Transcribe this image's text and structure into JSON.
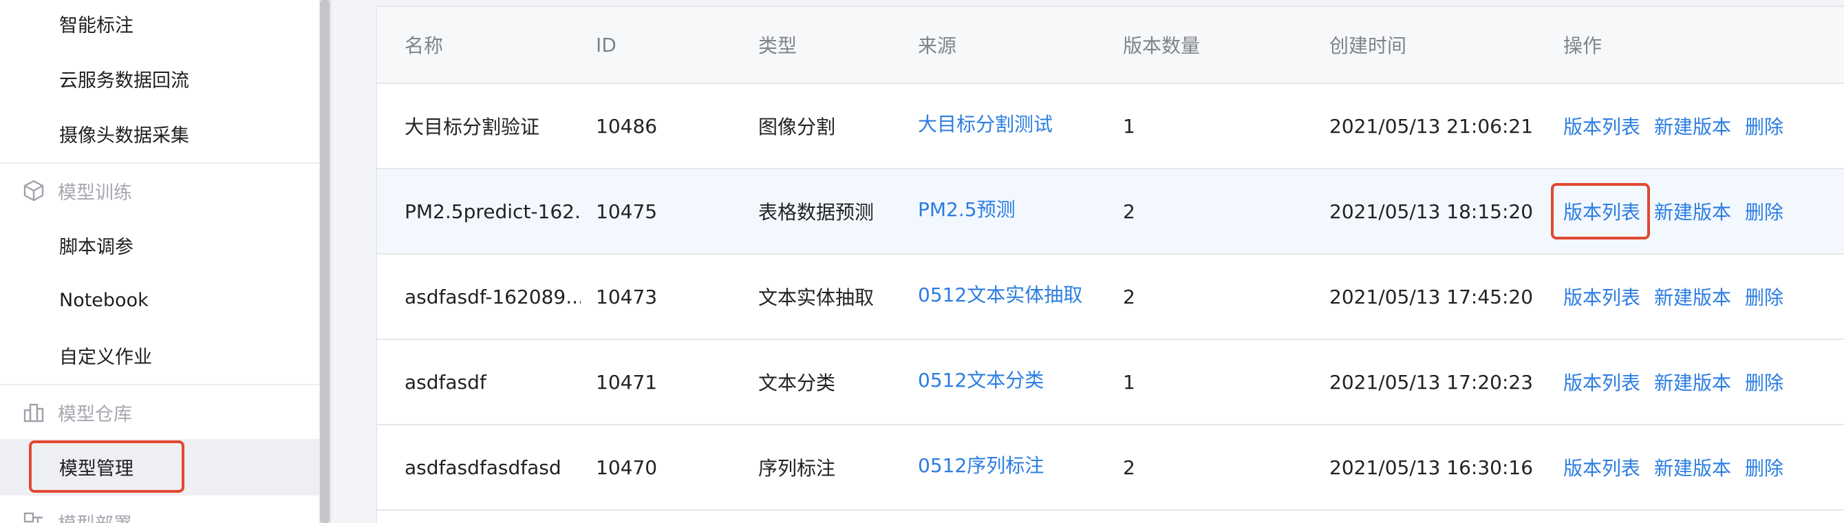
{
  "sidebar": {
    "items": [
      {
        "label": "智能标注"
      },
      {
        "label": "云服务数据回流"
      },
      {
        "label": "摄像头数据采集"
      },
      {
        "label": "模型训练"
      },
      {
        "label": "脚本调参"
      },
      {
        "label": "Notebook"
      },
      {
        "label": "自定义作业"
      },
      {
        "label": "模型仓库"
      },
      {
        "label": "模型管理"
      },
      {
        "label": "模型部署"
      }
    ]
  },
  "table": {
    "headers": {
      "name": "名称",
      "id": "ID",
      "type": "类型",
      "source": "来源",
      "versions": "版本数量",
      "created": "创建时间",
      "actions": "操作"
    },
    "actions": {
      "version_list": "版本列表",
      "new_version": "新建版本",
      "delete": "删除"
    },
    "rows": [
      {
        "name": "大目标分割验证",
        "id": "10486",
        "type": "图像分割",
        "source": "大目标分割测试",
        "versions": "1",
        "created": "2021/05/13 21:06:21"
      },
      {
        "name": "PM2.5predict-162...",
        "id": "10475",
        "type": "表格数据预测",
        "source": "PM2.5预测",
        "versions": "2",
        "created": "2021/05/13 18:15:20"
      },
      {
        "name": "asdfasdf-162089...",
        "id": "10473",
        "type": "文本实体抽取",
        "source": "0512文本实体抽取",
        "versions": "2",
        "created": "2021/05/13 17:45:20"
      },
      {
        "name": "asdfasdf",
        "id": "10471",
        "type": "文本分类",
        "source": "0512文本分类",
        "versions": "1",
        "created": "2021/05/13 17:20:23"
      },
      {
        "name": "asdfasdfasdfasd",
        "id": "10470",
        "type": "序列标注",
        "source": "0512序列标注",
        "versions": "2",
        "created": "2021/05/13 16:30:16"
      }
    ]
  },
  "icons": {
    "model_training": "cube-icon",
    "model_repository": "building-icon",
    "model_deployment": "deploy-icon"
  },
  "colors": {
    "accent": "#2b7de0",
    "highlight": "#e14830",
    "row_hover": "#f3f8ff"
  }
}
